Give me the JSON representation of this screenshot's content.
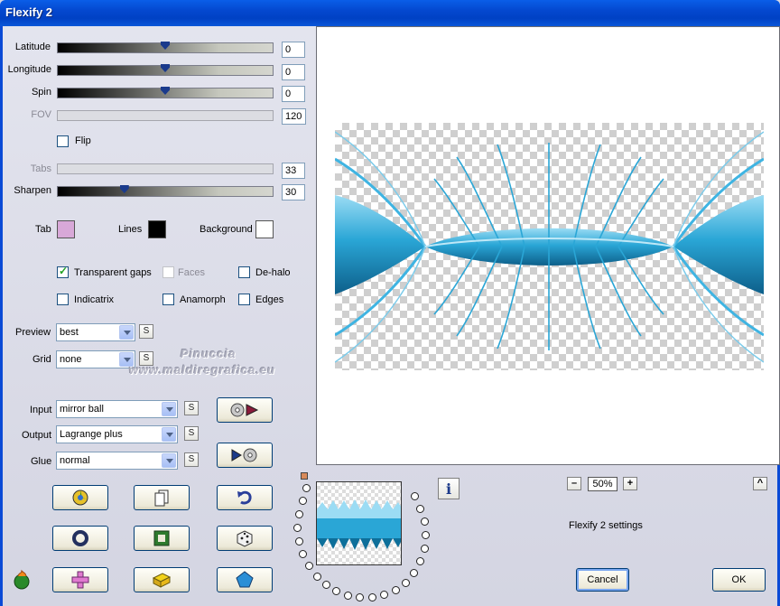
{
  "window": {
    "title": "Flexify 2"
  },
  "sliders": [
    {
      "label": "Latitude",
      "value": "0",
      "level": 0.5,
      "enabled": true
    },
    {
      "label": "Longitude",
      "value": "0",
      "level": 0.5,
      "enabled": true
    },
    {
      "label": "Spin",
      "value": "0",
      "level": 0.5,
      "enabled": true
    },
    {
      "label": "FOV",
      "value": "120",
      "level": null,
      "enabled": false
    },
    {
      "label": "Tabs",
      "value": "33",
      "level": null,
      "enabled": false
    },
    {
      "label": "Sharpen",
      "value": "30",
      "level": 0.3,
      "enabled": true
    }
  ],
  "flip": {
    "label": "Flip",
    "checked": false
  },
  "colors": {
    "tab": {
      "label": "Tab",
      "hex": "#d8a8d8"
    },
    "lines": {
      "label": "Lines",
      "hex": "#000000"
    },
    "background": {
      "label": "Background",
      "hex": "#ffffff"
    }
  },
  "options": {
    "transparent_gaps": {
      "label": "Transparent gaps",
      "checked": true
    },
    "faces": {
      "label": "Faces",
      "checked": false,
      "enabled": false
    },
    "de_halo": {
      "label": "De-halo",
      "checked": false
    },
    "indicatrix": {
      "label": "Indicatrix",
      "checked": false
    },
    "anamorph": {
      "label": "Anamorph",
      "checked": false
    },
    "edges": {
      "label": "Edges",
      "checked": false
    }
  },
  "dropdowns": {
    "preview": {
      "label": "Preview",
      "value": "best"
    },
    "grid": {
      "label": "Grid",
      "value": "none"
    },
    "input": {
      "label": "Input",
      "value": "mirror ball"
    },
    "output": {
      "label": "Output",
      "value": "Lagrange plus"
    },
    "glue": {
      "label": "Glue",
      "value": "normal"
    }
  },
  "small_button_label": "S",
  "watermark": {
    "line1": "Pinuccia",
    "line2": "www.maldiregrafica.eu"
  },
  "zoom": {
    "value": "50%",
    "minus": "–",
    "plus": "+"
  },
  "up_button": "^",
  "info_icon": "i",
  "settings_text": "Flexify 2 settings",
  "buttons": {
    "cancel": "Cancel",
    "ok": "OK"
  },
  "accent": {
    "title_bar": "#0054e3",
    "preview_blue": "#2aa6d6"
  }
}
